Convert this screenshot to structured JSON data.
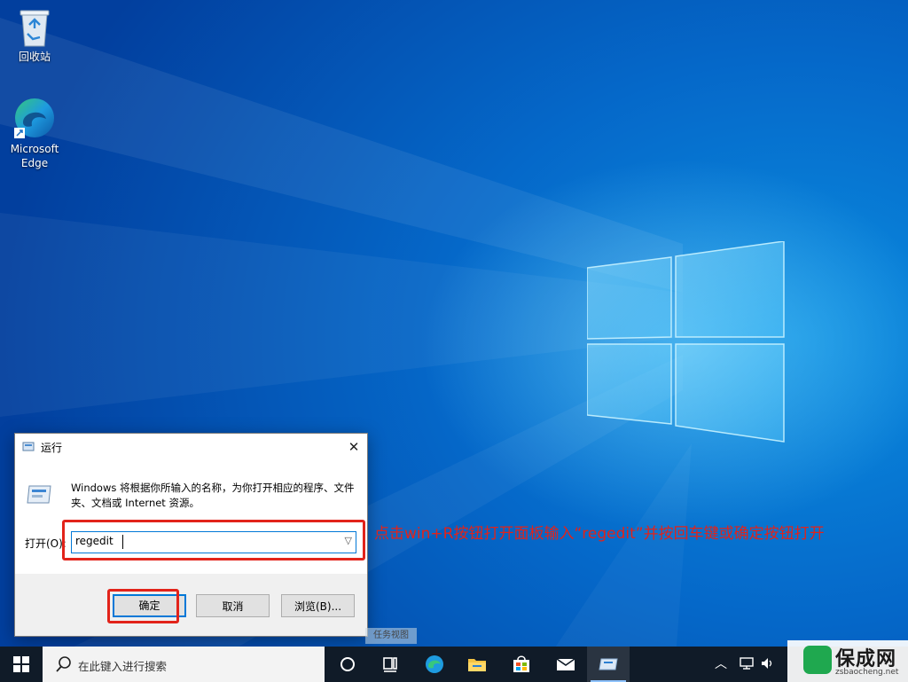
{
  "desktop": {
    "icons": [
      {
        "label": "回收站",
        "icon": "recycle-bin-icon"
      },
      {
        "label": "Microsoft Edge",
        "icon": "edge-icon"
      }
    ]
  },
  "run_dialog": {
    "title": "运行",
    "description": "Windows 将根据你所输入的名称，为你打开相应的程序、文件夹、文档或 Internet 资源。",
    "open_label": "打开(O):",
    "input_value": "regedit",
    "ok_label": "确定",
    "cancel_label": "取消",
    "browse_label": "浏览(B)..."
  },
  "annotation": {
    "text": "点击win+R按钮打开面板输入“regedit”并按回车键或确定按钮打开",
    "color": "#e2231a"
  },
  "tooltip": {
    "text": "任务视图"
  },
  "taskbar": {
    "search_placeholder": "在此键入进行搜索",
    "pinned": [
      "cortana-icon",
      "task-view-icon",
      "edge-icon",
      "file-explorer-icon",
      "store-icon",
      "mail-icon",
      "run-icon"
    ]
  },
  "watermark": {
    "brand": "保成网",
    "domain": "zsbaocheng.net"
  }
}
